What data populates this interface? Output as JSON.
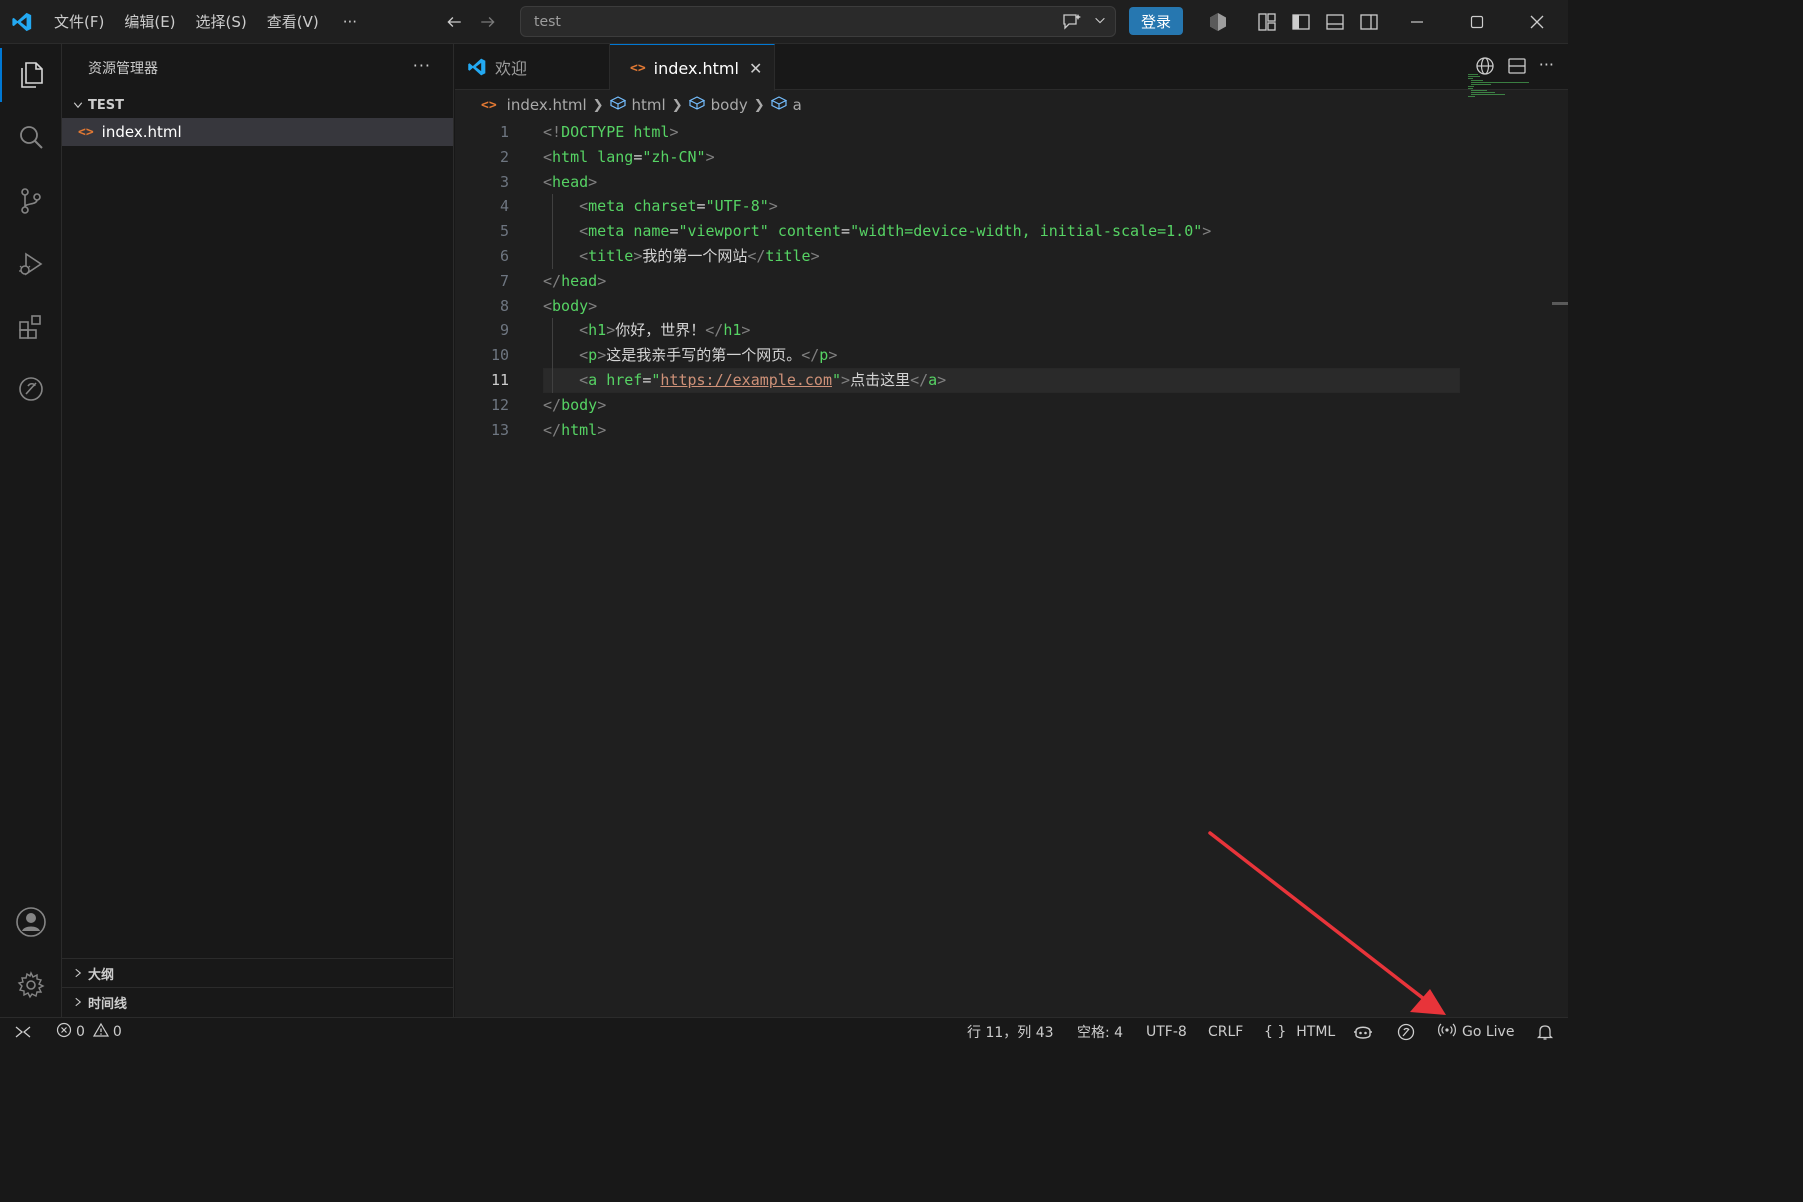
{
  "titlebar": {
    "menu": [
      "文件(F)",
      "编辑(E)",
      "选择(S)",
      "查看(V)"
    ],
    "menu_more": "···",
    "search_text": "test",
    "login_label": "登录"
  },
  "sidebar": {
    "header": "资源管理器",
    "header_more": "···",
    "folder": "TEST",
    "files": [
      "index.html"
    ],
    "outline": "大纲",
    "timeline": "时间线"
  },
  "editor": {
    "tabs": [
      {
        "label": "欢迎",
        "icon": "vscode-logo-icon",
        "active": false
      },
      {
        "label": "index.html",
        "icon": "html-file-icon",
        "active": true
      }
    ],
    "breadcrumbs": [
      "index.html",
      "html",
      "body",
      "a"
    ],
    "current_line": 11,
    "line_numbers": [
      "1",
      "2",
      "3",
      "4",
      "5",
      "6",
      "7",
      "8",
      "9",
      "10",
      "11",
      "12",
      "13"
    ],
    "lines": [
      [
        [
          "br",
          "<!"
        ],
        [
          "kw",
          "DOCTYPE"
        ],
        [
          "txt",
          " "
        ],
        [
          "kw",
          "html"
        ],
        [
          "br",
          ">"
        ]
      ],
      [
        [
          "br",
          "<"
        ],
        [
          "kw",
          "html"
        ],
        [
          "txt",
          " "
        ],
        [
          "kw",
          "lang"
        ],
        [
          "txt",
          "="
        ],
        [
          "kw",
          "\"zh-CN\""
        ],
        [
          "br",
          ">"
        ]
      ],
      [
        [
          "br",
          "<"
        ],
        [
          "kw",
          "head"
        ],
        [
          "br",
          ">"
        ]
      ],
      [
        [
          "txt",
          "    "
        ],
        [
          "br",
          "<"
        ],
        [
          "kw",
          "meta"
        ],
        [
          "txt",
          " "
        ],
        [
          "kw",
          "charset"
        ],
        [
          "txt",
          "="
        ],
        [
          "kw",
          "\"UTF-8\""
        ],
        [
          "br",
          ">"
        ]
      ],
      [
        [
          "txt",
          "    "
        ],
        [
          "br",
          "<"
        ],
        [
          "kw",
          "meta"
        ],
        [
          "txt",
          " "
        ],
        [
          "kw",
          "name"
        ],
        [
          "txt",
          "="
        ],
        [
          "kw",
          "\"viewport\""
        ],
        [
          "txt",
          " "
        ],
        [
          "kw",
          "content"
        ],
        [
          "txt",
          "="
        ],
        [
          "kw",
          "\"width=device-width, initial-scale=1.0\""
        ],
        [
          "br",
          ">"
        ]
      ],
      [
        [
          "txt",
          "    "
        ],
        [
          "br",
          "<"
        ],
        [
          "kw",
          "title"
        ],
        [
          "br",
          ">"
        ],
        [
          "txt",
          "我的第一个网站"
        ],
        [
          "br",
          "</"
        ],
        [
          "kw",
          "title"
        ],
        [
          "br",
          ">"
        ]
      ],
      [
        [
          "br",
          "</"
        ],
        [
          "kw",
          "head"
        ],
        [
          "br",
          ">"
        ]
      ],
      [
        [
          "br",
          "<"
        ],
        [
          "kw",
          "body"
        ],
        [
          "br",
          ">"
        ]
      ],
      [
        [
          "txt",
          "    "
        ],
        [
          "br",
          "<"
        ],
        [
          "kw",
          "h1"
        ],
        [
          "br",
          ">"
        ],
        [
          "txt",
          "你好，世界！"
        ],
        [
          "br",
          "</"
        ],
        [
          "kw",
          "h1"
        ],
        [
          "br",
          ">"
        ]
      ],
      [
        [
          "txt",
          "    "
        ],
        [
          "br",
          "<"
        ],
        [
          "kw",
          "p"
        ],
        [
          "br",
          ">"
        ],
        [
          "txt",
          "这是我亲手写的第一个网页。"
        ],
        [
          "br",
          "</"
        ],
        [
          "kw",
          "p"
        ],
        [
          "br",
          ">"
        ]
      ],
      [
        [
          "txt",
          "    "
        ],
        [
          "br",
          "<"
        ],
        [
          "kw",
          "a"
        ],
        [
          "txt",
          " "
        ],
        [
          "kw",
          "href"
        ],
        [
          "txt",
          "="
        ],
        [
          "kw",
          "\""
        ],
        [
          "link",
          "https://example.com"
        ],
        [
          "kw",
          "\""
        ],
        [
          "br",
          ">"
        ],
        [
          "txt",
          "点击这里"
        ],
        [
          "br",
          "</"
        ],
        [
          "kw",
          "a"
        ],
        [
          "br",
          ">"
        ]
      ],
      [
        [
          "br",
          "</"
        ],
        [
          "kw",
          "body"
        ],
        [
          "br",
          ">"
        ]
      ],
      [
        [
          "br",
          "</"
        ],
        [
          "kw",
          "html"
        ],
        [
          "br",
          ">"
        ]
      ]
    ]
  },
  "statusbar": {
    "errors": "0",
    "warnings": "0",
    "position": "行 11，列 43",
    "indent": "空格: 4",
    "encoding": "UTF-8",
    "eol": "CRLF",
    "language": "HTML",
    "language_icon": "{ }",
    "go_live": "Go Live"
  },
  "colors": {
    "accent": "#0078d4",
    "login_button": "#2677b0",
    "tag": "#56d364",
    "arrow": "#e8343a"
  }
}
